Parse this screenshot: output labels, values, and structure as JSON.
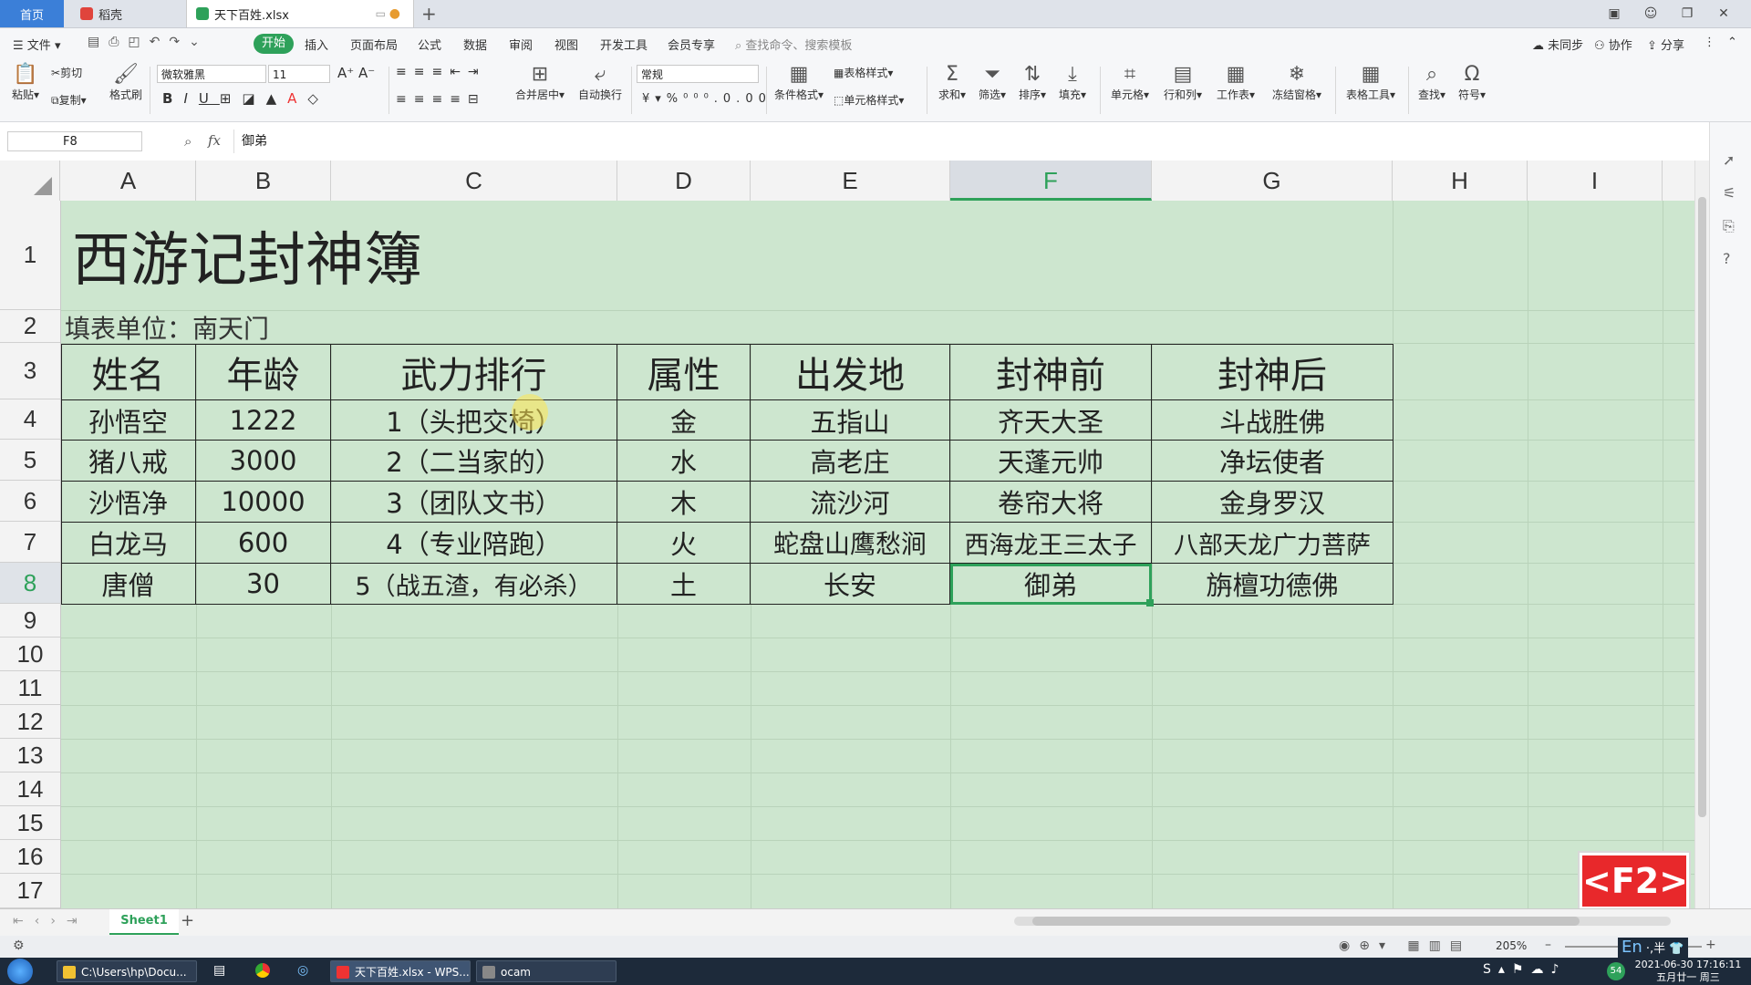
{
  "tabs": {
    "home": "首页",
    "daoke": "稻壳",
    "file": "天下百姓.xlsx"
  },
  "menu": [
    "文件",
    "开始",
    "插入",
    "页面布局",
    "公式",
    "数据",
    "审阅",
    "视图",
    "开发工具",
    "会员专享"
  ],
  "search_placeholder": "查找命令、搜索模板",
  "top_right": {
    "sync": "未同步",
    "collab": "协作",
    "share": "分享"
  },
  "ribbon": {
    "paste": "粘贴",
    "cut": "剪切",
    "copy": "复制",
    "format_painter": "格式刷",
    "font_name": "微软雅黑",
    "font_size": "11",
    "number_format": "常规",
    "merge_center": "合并居中",
    "wrap": "自动换行",
    "cond_format": "条件格式",
    "table_style": "表格样式",
    "cell_style": "单元格样式",
    "sum": "求和",
    "filter": "筛选",
    "sort": "排序",
    "fill": "填充",
    "cell": "单元格",
    "row_col": "行和列",
    "worksheet": "工作表",
    "freeze": "冻结窗格",
    "table_tools": "表格工具",
    "find": "查找",
    "symbol": "符号"
  },
  "formula_bar": {
    "name_box": "F8",
    "fx": "fx",
    "value": "御弟"
  },
  "columns": [
    "A",
    "B",
    "C",
    "D",
    "E",
    "F",
    "G",
    "H",
    "I"
  ],
  "rows": [
    "1",
    "2",
    "3",
    "4",
    "5",
    "6",
    "7",
    "8",
    "9",
    "10",
    "11",
    "12",
    "13",
    "14",
    "15",
    "16",
    "17"
  ],
  "sheet": {
    "title": "西游记封神簿",
    "unit": "填表单位：南天门",
    "headers": [
      "姓名",
      "年龄",
      "武力排行",
      "属性",
      "出发地",
      "封神前",
      "封神后"
    ],
    "data": [
      [
        "孙悟空",
        "1222",
        "1（头把交椅）",
        "金",
        "五指山",
        "齐天大圣",
        "斗战胜佛"
      ],
      [
        "猪八戒",
        "3000",
        "2（二当家的）",
        "水",
        "高老庄",
        "天蓬元帅",
        "净坛使者"
      ],
      [
        "沙悟净",
        "10000",
        "3（团队文书）",
        "木",
        "流沙河",
        "卷帘大将",
        "金身罗汉"
      ],
      [
        "白龙马",
        "600",
        "4（专业陪跑）",
        "火",
        "蛇盘山鹰愁涧",
        "西海龙王三太子",
        "八部天龙广力菩萨"
      ],
      [
        "唐僧",
        "30",
        "5（战五渣，有必杀）",
        "土",
        "长安",
        "御弟",
        "旃檀功德佛"
      ]
    ]
  },
  "sheet_tab": "Sheet1",
  "zoom": "205%",
  "f2_badge": "<F2>",
  "taskbar": {
    "items": [
      "C:\\Users\\hp\\Docu...",
      "天下百姓.xlsx - WPS...",
      "ocam"
    ],
    "ime": "En",
    "time": "2021-06-30 17:16:11",
    "date": "五月廿一 周三"
  },
  "colors": {
    "accent": "#2ea15a",
    "sheet_bg": "#cde6cf",
    "tab_home": "#3b7fd8"
  }
}
